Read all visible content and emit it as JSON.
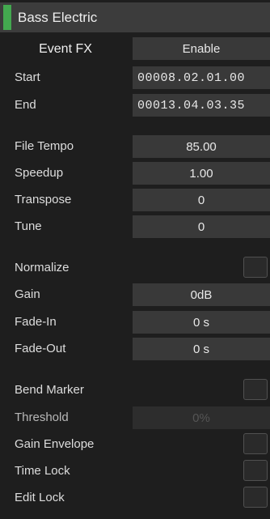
{
  "header": {
    "title": "Bass Electric",
    "accent_color": "#43a84f"
  },
  "event_fx": {
    "title": "Event FX",
    "button_label": "Enable"
  },
  "position": {
    "start_label": "Start",
    "start_value": "00008.02.01.00",
    "end_label": "End",
    "end_value": "00013.04.03.35"
  },
  "tempo": {
    "file_tempo_label": "File Tempo",
    "file_tempo_value": "85.00",
    "speedup_label": "Speedup",
    "speedup_value": "1.00",
    "transpose_label": "Transpose",
    "transpose_value": "0",
    "tune_label": "Tune",
    "tune_value": "0"
  },
  "level": {
    "normalize_label": "Normalize",
    "gain_label": "Gain",
    "gain_value": "0dB",
    "fade_in_label": "Fade-In",
    "fade_in_value": "0 s",
    "fade_out_label": "Fade-Out",
    "fade_out_value": "0 s"
  },
  "options": {
    "bend_marker_label": "Bend Marker",
    "threshold_label": "Threshold",
    "threshold_value": "0%",
    "gain_envelope_label": "Gain Envelope",
    "time_lock_label": "Time Lock",
    "edit_lock_label": "Edit Lock"
  }
}
